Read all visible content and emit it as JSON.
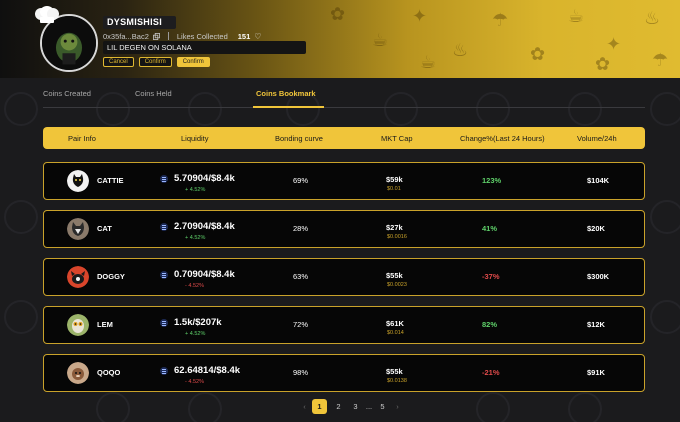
{
  "profile": {
    "username": "DYSMISHISI",
    "address": "0x35fa...Bac2",
    "likes_label": "Likes Collected",
    "likes_count": "151",
    "bio": "LIL DEGEN ON SOLANA",
    "buttons": [
      "Cancel",
      "Confirm",
      "Confirm"
    ]
  },
  "tabs": [
    {
      "label": "Coins Created",
      "active": false
    },
    {
      "label": "Coins Held",
      "active": false
    },
    {
      "label": "Coins Bookmark",
      "active": true
    }
  ],
  "table": {
    "headers": [
      "Pair Info",
      "Liquidity",
      "Bonding curve",
      "MKT Cap",
      "Change%(Last 24 Hours)",
      "Volume/24h"
    ],
    "rows": [
      {
        "name": "CATTIE",
        "liquidity": "5.70904/$8.4k",
        "liq_change": "+ 4.52%",
        "liq_dir": "up",
        "bonding": "69%",
        "mcap": "$59k",
        "price": "$0.01",
        "change": "123%",
        "change_dir": "up",
        "volume": "$104K"
      },
      {
        "name": "CAT",
        "liquidity": "2.70904/$8.4k",
        "liq_change": "+ 4.52%",
        "liq_dir": "up",
        "bonding": "28%",
        "mcap": "$27k",
        "price": "$0.0016",
        "change": "41%",
        "change_dir": "up",
        "volume": "$20K"
      },
      {
        "name": "DOGGY",
        "liquidity": "0.70904/$8.4k",
        "liq_change": "- 4.52%",
        "liq_dir": "down",
        "bonding": "63%",
        "mcap": "$55k",
        "price": "$0.0023",
        "change": "-37%",
        "change_dir": "down",
        "volume": "$300K"
      },
      {
        "name": "LEM",
        "liquidity": "1.5k/$207k",
        "liq_change": "+ 4.52%",
        "liq_dir": "up",
        "bonding": "72%",
        "mcap": "$61K",
        "price": "$0.014",
        "change": "82%",
        "change_dir": "up",
        "volume": "$12K"
      },
      {
        "name": "QOQO",
        "liquidity": "62.64814/$8.4k",
        "liq_change": "- 4.52%",
        "liq_dir": "down",
        "bonding": "98%",
        "mcap": "$55k",
        "price": "$0.0138",
        "change": "-21%",
        "change_dir": "down",
        "volume": "$91K"
      }
    ]
  },
  "pagination": {
    "prev": "‹",
    "pages": [
      "1",
      "2",
      "3",
      "...",
      "5"
    ],
    "current": "1",
    "next": "›"
  },
  "colors": {
    "accent": "#f0c53a",
    "up": "#5fd16a",
    "down": "#e04b4b",
    "row_border": "#c9a22a"
  },
  "icons": [
    "chef-hat-icon",
    "copy-icon",
    "heart-icon",
    "solana-icon"
  ]
}
